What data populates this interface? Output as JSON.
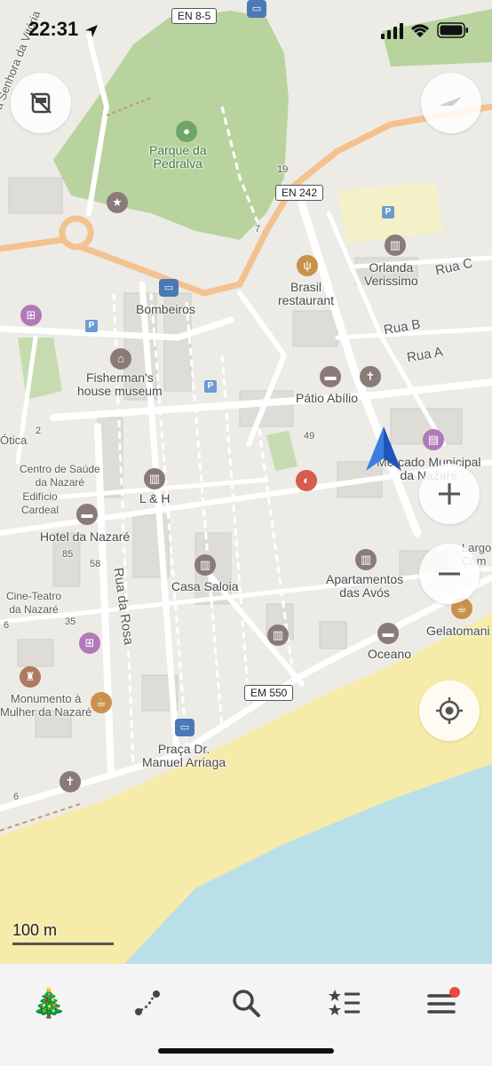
{
  "status": {
    "time": "22:31"
  },
  "roads": {
    "en85": "EN 8-5",
    "en242": "EN 242",
    "em550": "EM 550"
  },
  "places": {
    "parque": "Parque da\nPedralva",
    "bombeiros": "Bombeiros",
    "fisherman": "Fisherman's\nhouse museum",
    "brasil": "Brasil\nrestaurant",
    "orlanda": "Orlanda\nVerissimo",
    "patio": "Pátio Abílio",
    "mercado": "Mercado Municipal\nda Nazaré",
    "centro": "Centro de Saúde\nda Nazaré",
    "edificio": "Edifício\nCardeal",
    "lh": "L & H",
    "hotel": "Hotel da Nazaré",
    "casa": "Casa Saloia",
    "apartamentos": "Apartamentos\ndas Avós",
    "cineteatro": "Cine-Teatro\nda Nazaré",
    "oceano": "Oceano",
    "gelatomania": "Gelatomani",
    "monumento": "Monumento à\nMulher da Nazaré",
    "praca": "Praça Dr.\nManuel Arriaga",
    "largo": "Largo\nCâm",
    "senhora": "a Senhora da Vitória",
    "otica": "Ótica"
  },
  "streets": {
    "rua_c": "Rua C",
    "rua_b": "Rua B",
    "rua_a": "Rua A",
    "rua_rosa": "Rua da Rosa"
  },
  "numbers": {
    "n19": "19",
    "n7": "7",
    "n49": "49",
    "n2": "2",
    "n85": "85",
    "n58": "58",
    "n35": "35",
    "n6a": "6",
    "n6b": "6"
  },
  "scale": {
    "label": "100 m"
  },
  "tabs": [
    {
      "name": "tab-tree",
      "glyph": "🎄"
    },
    {
      "name": "tab-route",
      "glyph": ""
    },
    {
      "name": "tab-search",
      "glyph": ""
    },
    {
      "name": "tab-bookmarks",
      "glyph": ""
    },
    {
      "name": "tab-menu",
      "glyph": ""
    }
  ],
  "colors": {
    "land": "#ecebe6",
    "park": "#b9d39f",
    "beach": "#f7eba9",
    "sea": "#b9dfe9",
    "primary_road": "#f3c28f",
    "location_arrow": "#2f6fd6",
    "notification_dot": "#e74c3c"
  }
}
